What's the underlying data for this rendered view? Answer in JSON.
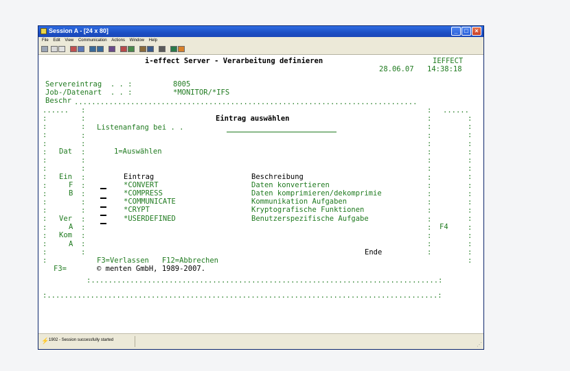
{
  "window": {
    "title": "Session A - [24 x 80]",
    "menu": [
      "File",
      "Edit",
      "View",
      "Communication",
      "Actions",
      "Window",
      "Help"
    ],
    "buttons": {
      "minimize": "_",
      "maximize": "□",
      "close": "×"
    }
  },
  "colors": {
    "terminal_text": "#1f7a1f",
    "terminal_text_bright": "#000000",
    "highlight": "#0058c0"
  },
  "terminal": {
    "header": {
      "title": "i-effect Server - Verarbeitung definieren",
      "right_label": "IEFFECT",
      "date": "28.06.07",
      "time": "14:38:18"
    },
    "fields": [
      {
        "label": "Servereintrag  . . :",
        "value": "8005"
      },
      {
        "label": "Job-/Datenart  . . :",
        "value": "*MONITOR/*IFS"
      },
      {
        "label": "Beschr",
        "value": ""
      }
    ],
    "popup": {
      "title": "Eintrag auswählen",
      "start_label": "Listenanfang bei . .",
      "options_label": "1=Auswählen",
      "col_entry": "Eintrag",
      "col_desc": "Beschreibung",
      "rows": [
        {
          "entry": "*CONVERT",
          "desc": "Daten konvertieren"
        },
        {
          "entry": "*COMPRESS",
          "desc": "Daten komprimieren/dekomprimie"
        },
        {
          "entry": "*COMMUNICATE",
          "desc": "Kommunikation Aufgaben"
        },
        {
          "entry": "*CRYPT",
          "desc": "Kryptografische Funktionen"
        },
        {
          "entry": "*USERDEFINED",
          "desc": "Benutzerspezifische Aufgabe"
        }
      ],
      "end_text": "Ende",
      "fkeys": "F3=Verlassen   F12=Abbrechen",
      "copyright": "© menten GmbH, 1989-2007."
    },
    "behind": {
      "dat": "Dat",
      "ein": "Ein",
      "f": "F",
      "b": "B",
      "ver": "Ver",
      "a": "A",
      "kom": "Kom",
      "a2": "A",
      "f3": "F3=",
      "f4": "F4"
    }
  },
  "status": {
    "text": "1902 - Session successfully started"
  }
}
